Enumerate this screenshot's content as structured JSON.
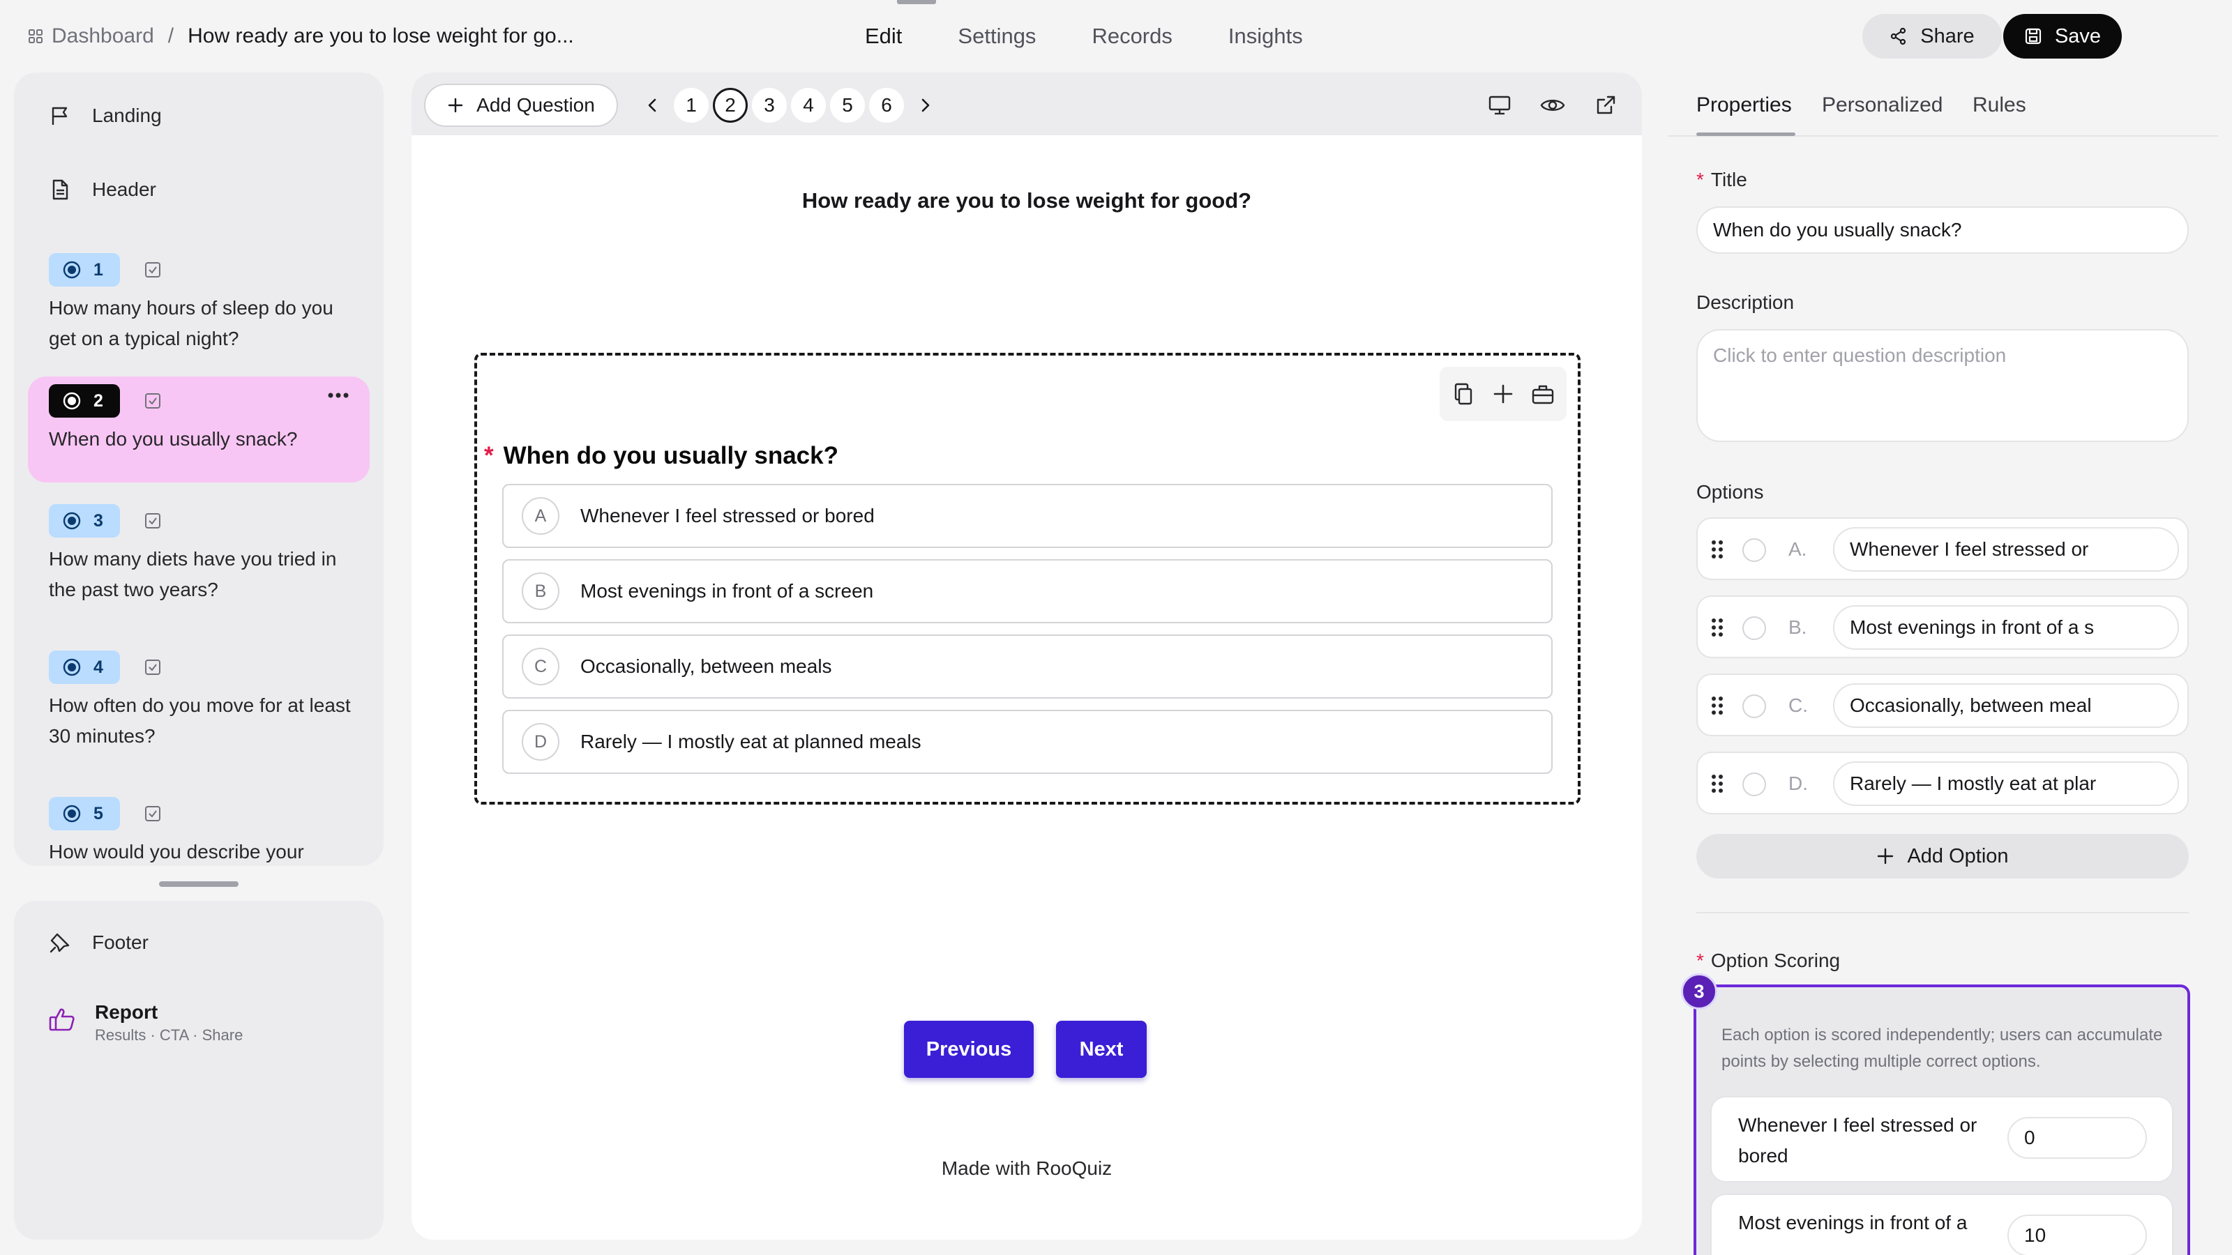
{
  "breadcrumb": {
    "home": "Dashboard",
    "separator": "/",
    "current": "How ready are you to lose weight for go..."
  },
  "top_tabs": [
    {
      "label": "Edit",
      "active": true
    },
    {
      "label": "Settings",
      "active": false
    },
    {
      "label": "Records",
      "active": false
    },
    {
      "label": "Insights",
      "active": false
    }
  ],
  "actions": {
    "share": "Share",
    "save": "Save"
  },
  "sidebar": {
    "landing": "Landing",
    "header": "Header",
    "questions": [
      {
        "num": "1",
        "text": "How many hours of sleep do you get on a typical night?"
      },
      {
        "num": "2",
        "text": "When do you usually snack?",
        "active": true
      },
      {
        "num": "3",
        "text": "How many diets have you tried in the past two years?"
      },
      {
        "num": "4",
        "text": "How often do you move for at least 30 minutes?"
      },
      {
        "num": "5",
        "text": "How would you describe your"
      }
    ],
    "footer": "Footer",
    "report": {
      "title": "Report",
      "subtitle": "Results · CTA · Share"
    }
  },
  "toolbar": {
    "add_question": "Add Question",
    "pages": [
      "1",
      "2",
      "3",
      "4",
      "5",
      "6"
    ],
    "current_page": "2"
  },
  "canvas": {
    "survey_title": "How ready are you to lose weight for good?",
    "question": {
      "required_mark": "*",
      "title": "When do you usually snack?",
      "options": [
        {
          "letter": "A",
          "text": "Whenever I feel stressed or bored"
        },
        {
          "letter": "B",
          "text": "Most evenings in front of a screen"
        },
        {
          "letter": "C",
          "text": "Occasionally, between meals"
        },
        {
          "letter": "D",
          "text": "Rarely — I mostly eat at planned meals"
        }
      ]
    },
    "prev_label": "Previous",
    "next_label": "Next",
    "branding": "Made with RooQuiz"
  },
  "properties": {
    "tabs": [
      "Properties",
      "Personalized",
      "Rules"
    ],
    "title_label": "Title",
    "title_value": "When do you usually snack?",
    "description_label": "Description",
    "description_placeholder": "Click to enter question description",
    "options_label": "Options",
    "options": [
      {
        "letter": "A.",
        "value": "Whenever I feel stressed or"
      },
      {
        "letter": "B.",
        "value": "Most evenings in front of a s"
      },
      {
        "letter": "C.",
        "value": "Occasionally, between meal"
      },
      {
        "letter": "D.",
        "value": "Rarely — I mostly eat at plar"
      }
    ],
    "add_option": "Add Option",
    "scoring": {
      "label": "Option Scoring",
      "badge": "3",
      "hint": "Each option is scored independently; users can accumulate points by selecting multiple correct options.",
      "rows": [
        {
          "label": "Whenever I feel stressed or bored",
          "score": "0"
        },
        {
          "label": "Most evenings in front of a",
          "score": "10"
        }
      ]
    }
  },
  "colors": {
    "primary": "#3b1fd6",
    "active_item": "#f8c6f4",
    "badge": "#b9dcff",
    "scoring_border": "#6d28d9",
    "required": "#e11d48"
  }
}
